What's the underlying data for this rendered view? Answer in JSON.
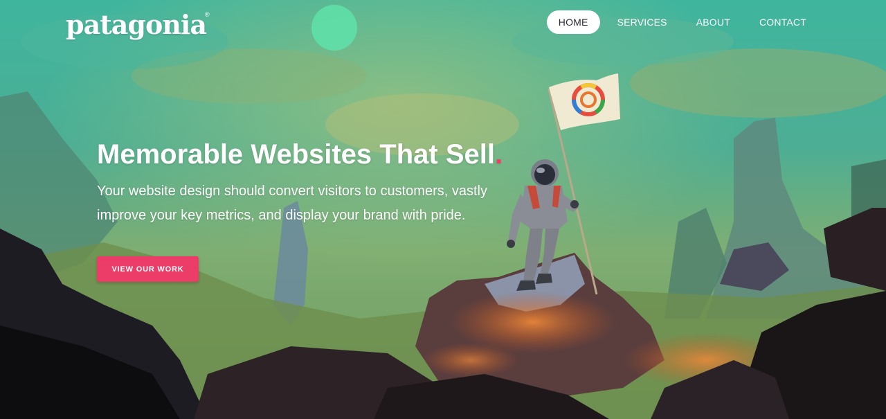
{
  "brand": {
    "logo_text": "patagonia",
    "logo_mark": "®"
  },
  "nav": {
    "items": [
      {
        "label": "HOME",
        "active": true
      },
      {
        "label": "SERVICES",
        "active": false
      },
      {
        "label": "ABOUT",
        "active": false
      },
      {
        "label": "CONTACT",
        "active": false
      }
    ]
  },
  "hero": {
    "headline": "Memorable Websites That Sell",
    "headline_accent": ".",
    "subtext": "Your website design should convert visitors to customers, vastly improve your key metrics, and display your brand with pride.",
    "cta_label": "VIEW OUR WORK",
    "background": "astronaut-planting-flag-illustration"
  },
  "colors": {
    "accent": "#ec3d69",
    "text": "#ffffff",
    "active_nav_text": "#2c2c3a"
  }
}
